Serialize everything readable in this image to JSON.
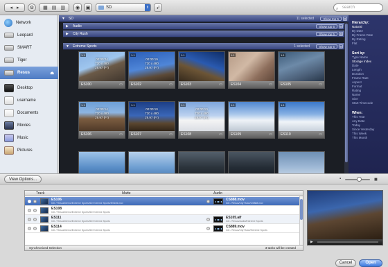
{
  "toolbar": {
    "back": "◂",
    "forward": "▸",
    "view_buttons": [
      "▦",
      "▤",
      "▥"
    ],
    "path_value": "SD",
    "search_placeholder": "search"
  },
  "sidebar": {
    "items": [
      {
        "label": "Network",
        "icon": "globe-icon"
      },
      {
        "label": "Leopard",
        "icon": "disk-icon"
      },
      {
        "label": "SMART",
        "icon": "disk-icon"
      },
      {
        "label": "Tiger",
        "icon": "disk-icon"
      },
      {
        "label": "Resus",
        "icon": "disk-icon",
        "selected": true,
        "eject": "⏏"
      },
      {
        "label": "Desktop",
        "icon": "desktop-icon"
      },
      {
        "label": "username",
        "icon": "home-icon"
      },
      {
        "label": "Documents",
        "icon": "documents-icon"
      },
      {
        "label": "Movies",
        "icon": "movies-icon"
      },
      {
        "label": "Music",
        "icon": "music-icon"
      },
      {
        "label": "Pictures",
        "icon": "pictures-icon"
      }
    ]
  },
  "groups": [
    {
      "label": "SD",
      "count": "11 selected",
      "show": "Show top 5"
    },
    {
      "label": "Audio",
      "count": "",
      "show": "Show top 5"
    },
    {
      "label": "City Rush",
      "count": "",
      "show": "Show top 5"
    },
    {
      "label": "Extreme Sports",
      "count": "1 selected",
      "show": "Show top 5"
    }
  ],
  "thumbnails": [
    {
      "caption": "ES100",
      "meta": "00:00:24\n720 x 480\n29.97 (Fr)",
      "tag": "1:1"
    },
    {
      "caption": "ES102",
      "meta": "00:00:19\n720 x 480\n29.97 (Fr)",
      "tag": "1:1"
    },
    {
      "caption": "ES103",
      "meta": "",
      "tag": "1:1"
    },
    {
      "caption": "ES104",
      "meta": "",
      "tag": "1:1"
    },
    {
      "caption": "ES105",
      "meta": "",
      "tag": "1:1"
    },
    {
      "caption": "ES106",
      "meta": "00:00:14\n720 x 480\n29.97 (Fr)",
      "tag": "1:1"
    },
    {
      "caption": "ES107",
      "meta": "00:00:10\n720 x 480\n29.97 (Fr)",
      "tag": "1:1"
    },
    {
      "caption": "ES108",
      "meta": "00:00:10\n720 x 480\n29.97 (Fr)",
      "tag": "1:1"
    },
    {
      "caption": "ES109",
      "meta": "",
      "tag": "1:1"
    },
    {
      "caption": "ES110",
      "meta": "",
      "tag": "1:1"
    },
    {
      "caption": "",
      "meta": "",
      "tag": ""
    },
    {
      "caption": "",
      "meta": "",
      "tag": ""
    },
    {
      "caption": "",
      "meta": "",
      "tag": ""
    },
    {
      "caption": "",
      "meta": "",
      "tag": ""
    },
    {
      "caption": "",
      "meta": "",
      "tag": ""
    }
  ],
  "right_panel": {
    "sections": [
      {
        "title": "Hierarchy:",
        "items": [
          "Natural",
          "By Date",
          "By Frame Rate",
          "By Rating",
          "Flat"
        ],
        "active": 0
      },
      {
        "title": "Sort by:",
        "items": [
          "Type Name",
          "Storage Index",
          "Date",
          "Length",
          "Duration",
          "Frame Rate",
          "Aspect",
          "Format",
          "Rating",
          "Name",
          "Size",
          "Start Timecode"
        ],
        "active": 1
      },
      {
        "title": "When:",
        "items": [
          "This Year",
          "Any Date",
          "Today",
          "Since Yesterday",
          "This Week",
          "This Month"
        ],
        "active": -1
      }
    ]
  },
  "bottombar": {
    "view_options": "View Options..."
  },
  "table": {
    "headers": {
      "track": "Track",
      "matte": "Matte",
      "audio": "Audio"
    },
    "rows": [
      {
        "name": "ES106",
        "path": "Intl: / Resus/Demo/Extreme Sports/SD Extreme Sports/ES106.mov",
        "audio_name": "CS888.mov",
        "audio_path": "Intl: / Resus/City Rush/CS888.mov",
        "selected": true
      },
      {
        "name": "ES108",
        "path": "Intl: / Resus/Demo/Extreme Sports/SD Extreme Sports",
        "audio_name": "",
        "audio_path": "",
        "selected": false
      },
      {
        "name": "ES111",
        "path": "Intl: / Resus/Demo/Extreme Sports/SD Extreme Sports",
        "audio_name": "ES105.aif",
        "audio_path": "Intl: / Resus/Audio/Extreme Sports",
        "selected": false
      },
      {
        "name": "ES114",
        "path": "Intl: / Resus/Demo/Extreme Sports/SD Extreme Sports",
        "audio_name": "CS889.mov",
        "audio_path": "Intl: / Resus/City Rush/Extreme Sports",
        "selected": false
      }
    ],
    "footer_left": "Synchronized Selection",
    "footer_right": "3 tasks will be created"
  },
  "buttons": {
    "cancel": "Cancel",
    "open": "Open"
  }
}
